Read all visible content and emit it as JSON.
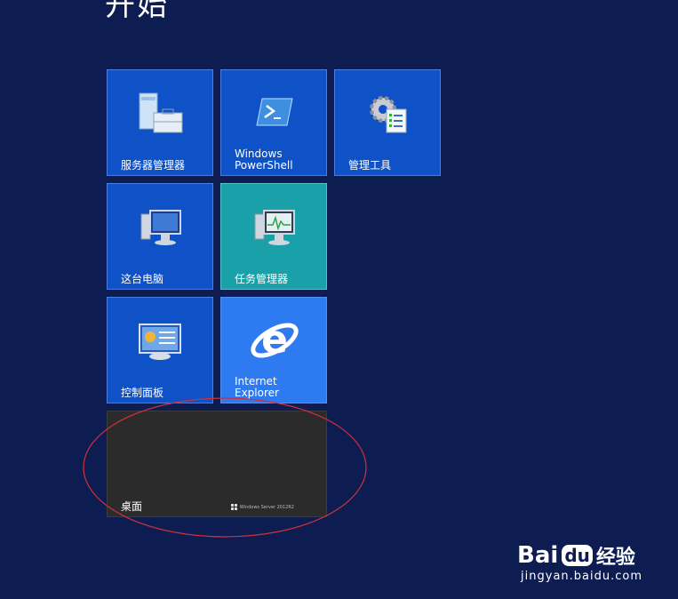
{
  "start": {
    "title": "开始"
  },
  "tiles": {
    "server_manager": {
      "label": "服务器管理器"
    },
    "powershell": {
      "label": "Windows\nPowerShell"
    },
    "admin_tools": {
      "label": "管理工具"
    },
    "this_pc": {
      "label": "这台电脑"
    },
    "task_manager": {
      "label": "任务管理器"
    },
    "control_panel": {
      "label": "控制面板"
    },
    "internet_explorer": {
      "label": "Internet\nExplorer"
    },
    "desktop": {
      "label": "桌面",
      "watermark": "Windows Server 2012R2"
    }
  },
  "watermark": {
    "brand_a": "Bai",
    "brand_b": "du",
    "brand_c": "经验",
    "url": "jingyan.baidu.com"
  },
  "colors": {
    "background": "#0d1d52",
    "tile_blue": "#0f52c8",
    "tile_teal": "#1aa0a8",
    "tile_ie": "#2e7af0",
    "tile_desktop": "#2b2b2b",
    "annotation": "#d0303a"
  }
}
